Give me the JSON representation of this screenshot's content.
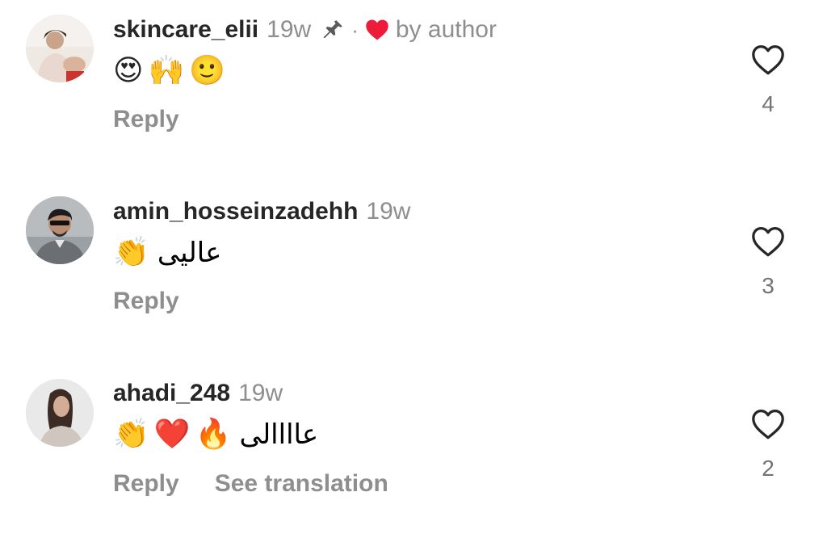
{
  "comments": [
    {
      "username": "skincare_elii",
      "time": "19w",
      "pinned": true,
      "liked_by_author_text": "by author",
      "emojis": [
        "😍",
        "🙌",
        "🙂"
      ],
      "text": "",
      "reply_label": "Reply",
      "likes": "4"
    },
    {
      "username": "amin_hosseinzadehh",
      "time": "19w",
      "emojis": [
        "👏"
      ],
      "text": "عالیی",
      "reply_label": "Reply",
      "likes": "3"
    },
    {
      "username": "ahadi_248",
      "time": "19w",
      "emojis": [
        "👏",
        "❤️",
        "🔥"
      ],
      "text": "عاااالی",
      "reply_label": "Reply",
      "see_translation_label": "See translation",
      "likes": "2"
    }
  ],
  "icons": {
    "pin": "pushpin-icon",
    "author_like": "red-heart-icon",
    "like": "heart-outline-icon"
  },
  "colors": {
    "username": "#262626",
    "meta": "#8e8e8e",
    "author_heart": "#ed1c3a",
    "like_outline": "#262626"
  }
}
